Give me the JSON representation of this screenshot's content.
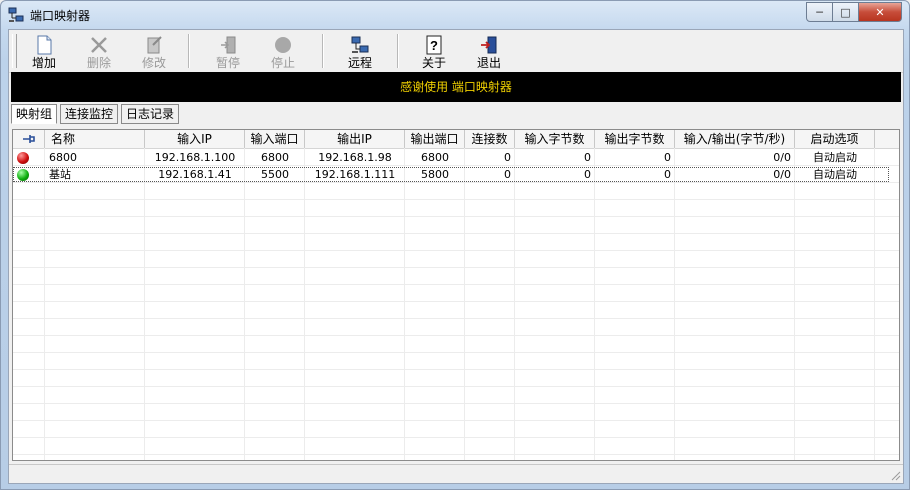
{
  "window": {
    "title": "端口映射器"
  },
  "toolbar": {
    "add": "增加",
    "delete": "删除",
    "edit": "修改",
    "pause": "暂停",
    "stop": "停止",
    "remote": "远程",
    "about": "关于",
    "exit": "退出"
  },
  "banner": "感谢使用 端口映射器",
  "tabs": [
    "映射组",
    "连接监控",
    "日志记录"
  ],
  "table": {
    "columns": [
      "名称",
      "输入IP",
      "输入端口",
      "输出IP",
      "输出端口",
      "连接数",
      "输入字节数",
      "输出字节数",
      "输入/输出(字节/秒)",
      "启动选项"
    ],
    "rows": [
      {
        "status": "red",
        "name": "6800",
        "in_ip": "192.168.1.100",
        "in_port": "6800",
        "out_ip": "192.168.1.98",
        "out_port": "6800",
        "conns": "0",
        "in_bytes": "0",
        "out_bytes": "0",
        "rate": "0/0",
        "start": "自动启动"
      },
      {
        "status": "green",
        "name": "基站",
        "in_ip": "192.168.1.41",
        "in_port": "5500",
        "out_ip": "192.168.1.111",
        "out_port": "5800",
        "conns": "0",
        "in_bytes": "0",
        "out_bytes": "0",
        "rate": "0/0",
        "start": "自动启动"
      }
    ]
  },
  "colors": {
    "banner_bg": "#000000",
    "banner_text": "#f0d000",
    "status_red": "#d01010",
    "status_green": "#10b010"
  }
}
